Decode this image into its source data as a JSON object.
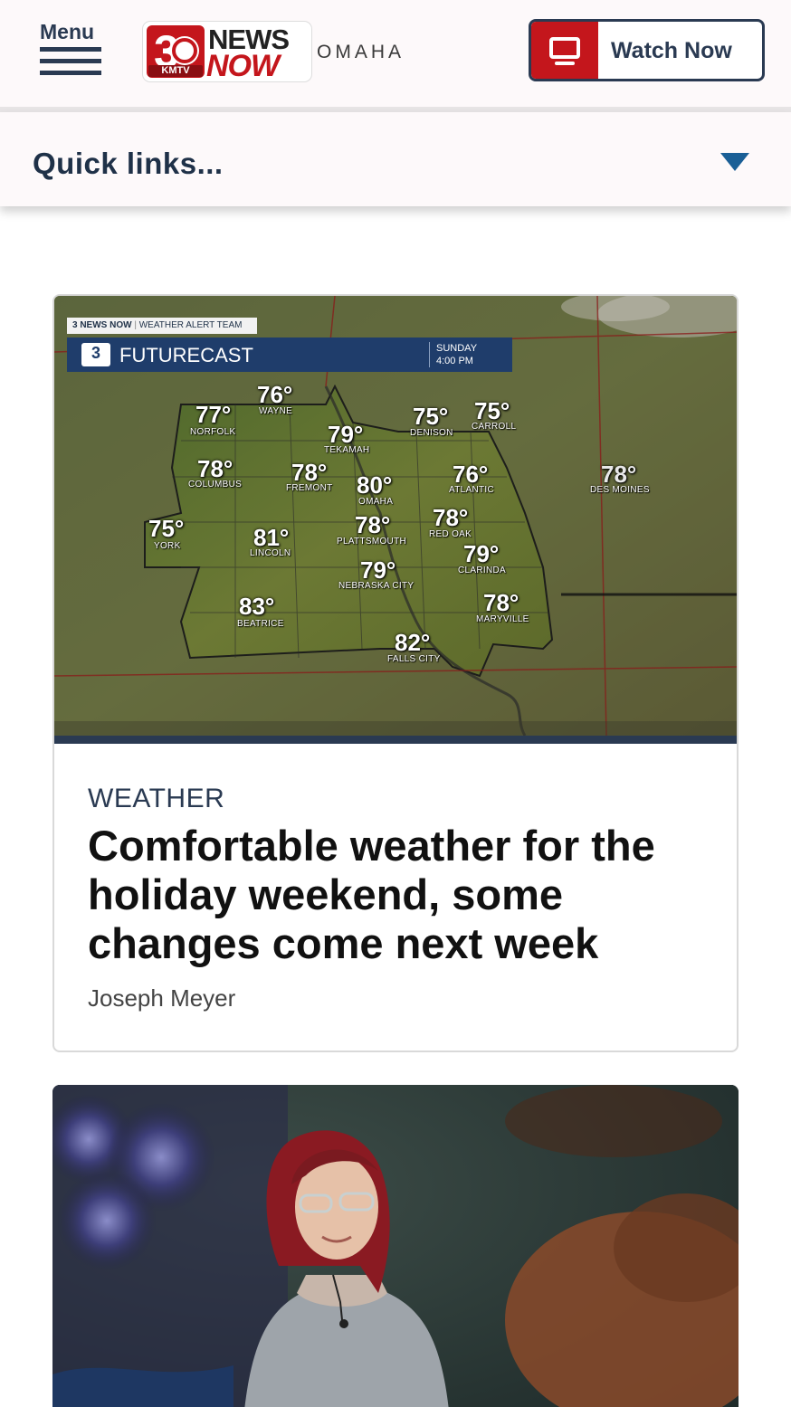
{
  "header": {
    "menu_label": "Menu",
    "logo": {
      "number": "3",
      "station": "KMTV",
      "news": "NEWS",
      "now": "NOW",
      "city": "OMAHA"
    },
    "watch_now_label": "Watch Now"
  },
  "quick_links": {
    "label": "Quick links..."
  },
  "articles": [
    {
      "category": "WEATHER",
      "headline": "Comfortable weather for the holiday weekend, some changes come next week",
      "author": "Joseph Meyer",
      "image": {
        "network_tag": "3 NEWS NOW",
        "team_tag": "WEATHER ALERT TEAM",
        "graphic_title": "FUTURECAST",
        "day": "SUNDAY",
        "time": "4:00 PM",
        "cities": [
          {
            "temp": "76°",
            "name": "WAYNE"
          },
          {
            "temp": "77°",
            "name": "NORFOLK"
          },
          {
            "temp": "79°",
            "name": "TEKAMAH"
          },
          {
            "temp": "75°",
            "name": "DENISON"
          },
          {
            "temp": "75°",
            "name": "CARROLL"
          },
          {
            "temp": "78°",
            "name": "COLUMBUS"
          },
          {
            "temp": "78°",
            "name": "FREMONT"
          },
          {
            "temp": "80°",
            "name": "OMAHA"
          },
          {
            "temp": "76°",
            "name": "ATLANTIC"
          },
          {
            "temp": "78°",
            "name": "DES MOINES"
          },
          {
            "temp": "75°",
            "name": "YORK"
          },
          {
            "temp": "81°",
            "name": "LINCOLN"
          },
          {
            "temp": "78°",
            "name": "PLATTSMOUTH"
          },
          {
            "temp": "78°",
            "name": "RED OAK"
          },
          {
            "temp": "79°",
            "name": "CLARINDA"
          },
          {
            "temp": "79°",
            "name": "NEBRASKA CITY"
          },
          {
            "temp": "83°",
            "name": "BEATRICE"
          },
          {
            "temp": "78°",
            "name": "MARYVILLE"
          },
          {
            "temp": "82°",
            "name": "FALLS CITY"
          }
        ]
      }
    },
    {
      "category": "",
      "headline": "",
      "author": ""
    }
  ],
  "colors": {
    "brand_red": "#c4161c",
    "navy": "#2a3a52",
    "link_blue": "#1a5f96"
  }
}
